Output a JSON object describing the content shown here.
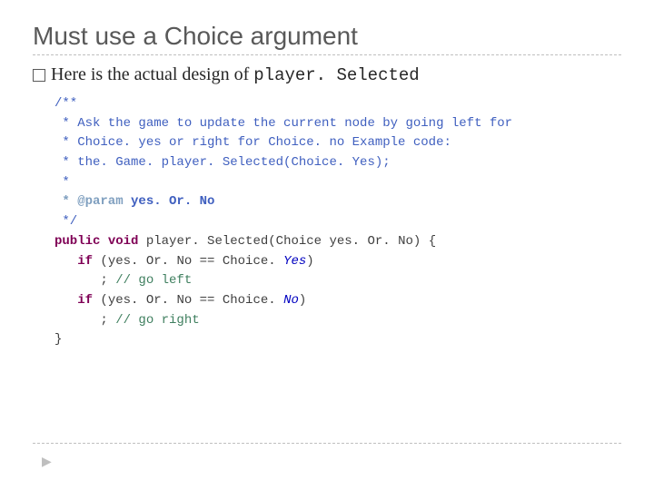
{
  "title": "Must use a Choice argument",
  "lead_prefix": "Here is the actual design of ",
  "lead_code": "player. Selected",
  "code": {
    "l1": "/**",
    "l2": " * Ask the game to update the current node by going left for",
    "l3": " * Choice. yes or right for Choice. no Example code:",
    "l4": " * the. Game. player. Selected(Choice. Yes);",
    "l5": " * ",
    "l6_tag": " * @param",
    "l6_arg": " yes. Or. No",
    "l7": " */",
    "kw_public": "public",
    "kw_void": "void",
    "sig_rest": " player. Selected(Choice yes. Or. No) {",
    "kw_if": "if",
    "cond1_a": " (yes. Or. No == Choice. ",
    "yes": "Yes",
    "cond_close": ")",
    "stmt1": "      ; ",
    "com1": "// go left",
    "cond2_a": " (yes. Or. No == Choice. ",
    "no": "No",
    "stmt2": "      ; ",
    "com2": "// go right",
    "end": "}"
  }
}
